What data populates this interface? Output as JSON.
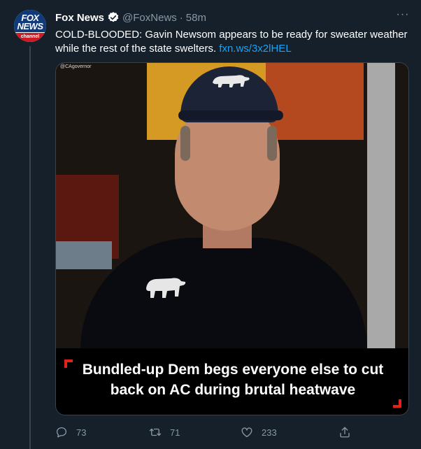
{
  "tweet": {
    "author_name": "Fox News",
    "handle": "@FoxNews",
    "separator": "·",
    "timestamp": "58m",
    "verified": true,
    "more_icon": "more-horizontal-icon",
    "text": "COLD-BLOODED: Gavin Newsom appears to be ready for sweater weather while the rest of the state swelters. ",
    "link_text": "fxn.ws/3x2lHEL"
  },
  "avatar": {
    "line1": "FOX",
    "line2": "NEWS",
    "line3": "channel"
  },
  "media": {
    "watermark": "@CAgovernor",
    "caption": "Bundled-up Dem begs everyone else to cut back on AC during brutal heatwave"
  },
  "actions": {
    "reply_count": "73",
    "retweet_count": "71",
    "like_count": "233",
    "icons": [
      "reply-icon",
      "retweet-icon",
      "like-icon",
      "share-icon"
    ]
  },
  "colors": {
    "background": "#15202b",
    "secondary_text": "#8899a6",
    "link": "#1da1f2",
    "caption_accent": "#e2231a"
  }
}
